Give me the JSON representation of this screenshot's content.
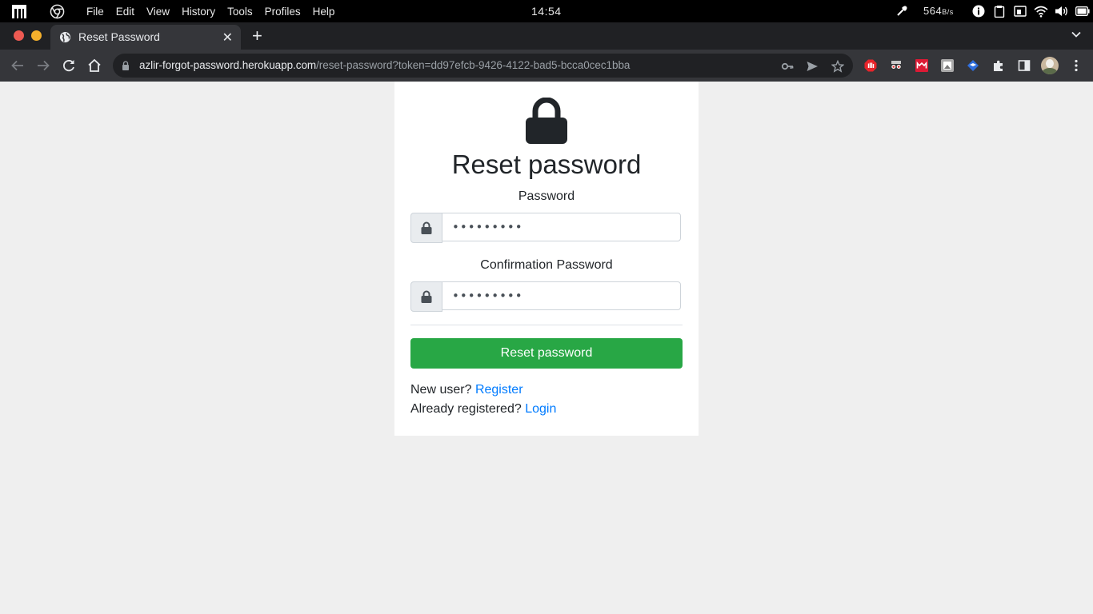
{
  "os_bar": {
    "menu": [
      "File",
      "Edit",
      "View",
      "History",
      "Tools",
      "Profiles",
      "Help"
    ],
    "clock": "14:54",
    "net_speed": "564",
    "net_unit": "B/s"
  },
  "browser": {
    "tab_title": "Reset Password",
    "url_host": "azlir-forgot-password.herokuapp.com",
    "url_path": "/reset-password?token=dd97efcb-9426-4122-bad5-bcca0cec1bba"
  },
  "page": {
    "heading": "Reset password",
    "password_label": "Password",
    "password_value": "•••••••••",
    "confirm_label": "Confirmation Password",
    "confirm_value": "•••••••••",
    "submit_label": "Reset password",
    "new_user_text": "New user?",
    "register_link": "Register",
    "already_text": "Already registered?",
    "login_link": "Login"
  },
  "colors": {
    "primary_button": "#28a745",
    "link": "#007bff",
    "page_background": "#efefef"
  }
}
